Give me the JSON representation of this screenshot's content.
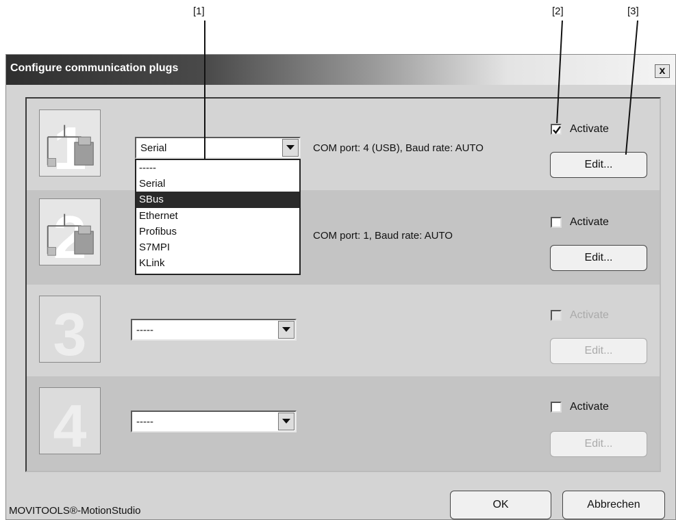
{
  "callouts": [
    "[1]",
    "[2]",
    "[3]"
  ],
  "dialog": {
    "title": "Configure communication plugs",
    "close_label": "x"
  },
  "plugs": [
    {
      "number": "1",
      "selected": "Serial",
      "info": "COM port: 4 (USB), Baud rate: AUTO",
      "activate_label": "Activate",
      "activate_checked": true,
      "edit_label": "Edit..."
    },
    {
      "number": "2",
      "selected": "SBus",
      "info": "COM port: 1, Baud rate: AUTO",
      "activate_label": "Activate",
      "activate_checked": false,
      "edit_label": "Edit..."
    },
    {
      "number": "3",
      "selected": "-----",
      "info": "",
      "activate_label": "Activate",
      "activate_checked": false,
      "edit_label": "Edit...",
      "disabled": true
    },
    {
      "number": "4",
      "selected": "-----",
      "info": "",
      "activate_label": "Activate",
      "activate_checked": false,
      "edit_label": "Edit..."
    }
  ],
  "dropdown": {
    "options": [
      "-----",
      "Serial",
      "SBus",
      "Ethernet",
      "Profibus",
      "S7MPI",
      "KLink"
    ],
    "highlighted": "SBus"
  },
  "footer": {
    "brand": "MOVITOOLS®-MotionStudio",
    "ok_label": "OK",
    "cancel_label": "Abbrechen"
  }
}
